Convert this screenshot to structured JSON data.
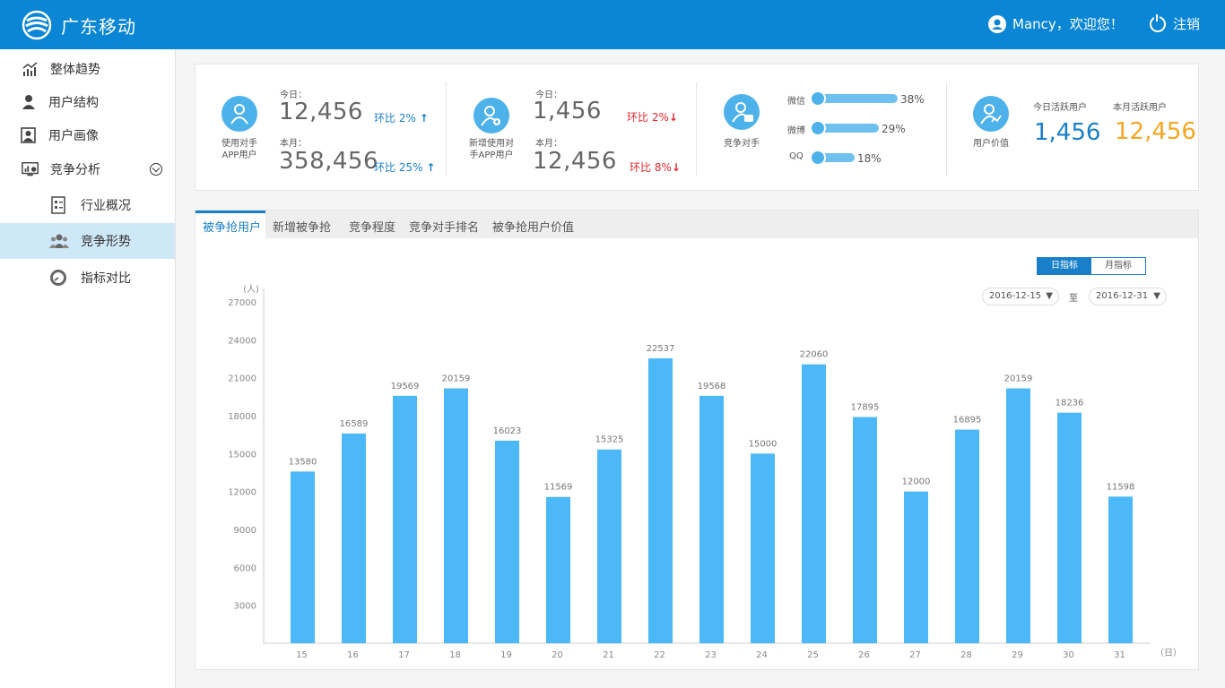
{
  "header": {
    "brand": "广东移动",
    "user_greeting": "Mancy，欢迎您！",
    "logout_label": "注销",
    "color": "#0a86d4"
  },
  "sidebar": {
    "items": [
      {
        "label": "整体趋势",
        "icon": "trend-chart-icon"
      },
      {
        "label": "用户结构",
        "icon": "user-icon"
      },
      {
        "label": "用户画像",
        "icon": "user-portrait-icon"
      },
      {
        "label": "竞争分析",
        "icon": "competition-monitor-icon"
      },
      {
        "label": "行业概况",
        "icon": "document-list-icon"
      },
      {
        "label": "竞争形势",
        "icon": "group-icon",
        "active": true
      },
      {
        "label": "指标对比",
        "icon": "gauge-icon"
      }
    ]
  },
  "stats": {
    "app_users": {
      "caption_line1": "使用对手",
      "caption_line2": "APP用户",
      "today_label": "今日：",
      "today_value": "12,456",
      "today_ratio": "环比 2%",
      "today_dir": "up",
      "month_label": "本月：",
      "month_value": "358,456",
      "month_ratio": "环比 25%",
      "month_dir": "up"
    },
    "new_app_users": {
      "caption_line1": "新增使用对",
      "caption_line2": "手APP用户",
      "today_label": "今日：",
      "today_value": "1,456",
      "today_ratio": "环比 2%",
      "today_dir": "down",
      "month_label": "本月：",
      "month_value": "12,456",
      "month_ratio": "环比 8%",
      "month_dir": "down"
    },
    "competitors": {
      "caption": "竞争对手",
      "items": [
        {
          "name": "微信",
          "percent": 38,
          "label": "38%",
          "icon": "wechat-icon"
        },
        {
          "name": "微博",
          "percent": 29,
          "label": "29%",
          "icon": "weibo-icon"
        },
        {
          "name": "QQ",
          "percent": 18,
          "label": "18%",
          "icon": "qq-icon"
        }
      ]
    },
    "user_value": {
      "caption": "用户价值",
      "today_active_label": "今日活跃用户",
      "today_active_value": "1,456",
      "month_active_label": "本月活跃用户",
      "month_active_value": "12,456",
      "today_color": "#1a7fc9",
      "month_color": "#f5a623"
    }
  },
  "tabs": [
    {
      "label": "被争抢用户",
      "active": true
    },
    {
      "label": "新增被争抢"
    },
    {
      "label": "竞争程度"
    },
    {
      "label": "竞争对手排名"
    },
    {
      "label": "被争抢用户价值"
    }
  ],
  "controls": {
    "toggle_day": "日指标",
    "toggle_month": "月指标",
    "start_date": "2016-12-15",
    "end_date": "2016-12-31",
    "date_sep": "至"
  },
  "chart_data": {
    "type": "bar",
    "ylabel": "(人)",
    "xlabel": "（日）",
    "ylim": [
      0,
      27000
    ],
    "yticks": [
      3000,
      6000,
      9000,
      12000,
      15000,
      18000,
      21000,
      24000,
      27000
    ],
    "categories": [
      "15",
      "16",
      "17",
      "18",
      "19",
      "20",
      "21",
      "22",
      "23",
      "24",
      "25",
      "26",
      "27",
      "28",
      "29",
      "30",
      "31"
    ],
    "values": [
      13580,
      16589,
      19569,
      20159,
      16023,
      11569,
      15325,
      22537,
      19568,
      15000,
      22060,
      17895,
      12000,
      16895,
      20159,
      18236,
      11598
    ],
    "bar_color": "#4db8f8",
    "grid": false
  }
}
